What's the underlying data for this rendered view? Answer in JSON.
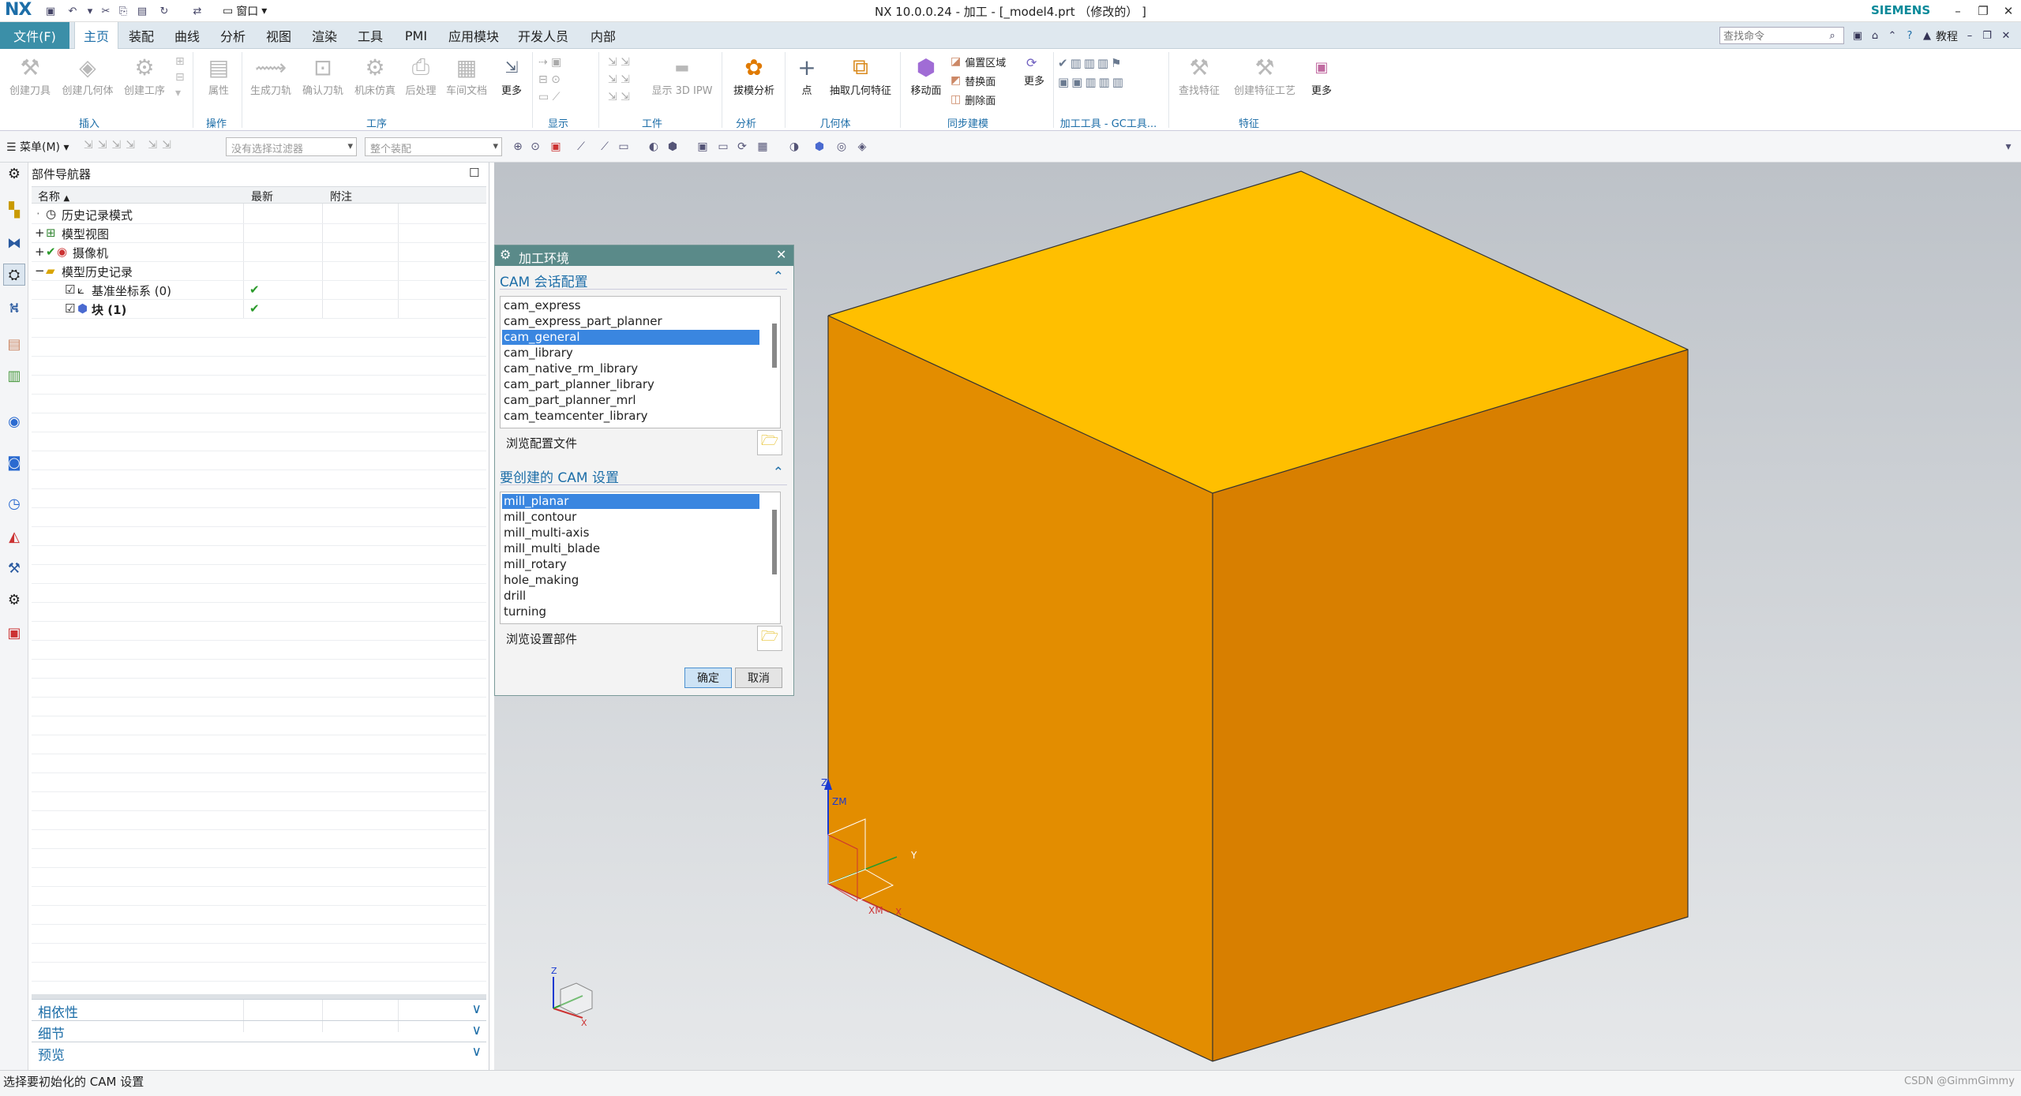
{
  "titlebar": {
    "logo": "NX",
    "window_menu": "窗口",
    "title": "NX 10.0.0.24 - 加工 - [_model4.prt （修改的） ]",
    "brand": "SIEMENS"
  },
  "menu": {
    "file": "文件(F)",
    "tabs": [
      "主页",
      "装配",
      "曲线",
      "分析",
      "视图",
      "渲染",
      "工具",
      "PMI",
      "应用模块",
      "开发人员",
      "内部"
    ],
    "search_placeholder": "查找命令",
    "help_label": "教程"
  },
  "ribbon": {
    "buttons": [
      {
        "label": "创建刀具",
        "icon": "tool-icon"
      },
      {
        "label": "创建几何体",
        "icon": "geometry-icon"
      },
      {
        "label": "创建工序",
        "icon": "operation-icon"
      },
      {
        "label": "属性",
        "icon": "properties-icon"
      },
      {
        "label": "生成刀轨",
        "icon": "generate-path-icon"
      },
      {
        "label": "确认刀轨",
        "icon": "verify-path-icon"
      },
      {
        "label": "机床仿真",
        "icon": "machine-sim-icon"
      },
      {
        "label": "后处理",
        "icon": "postprocess-icon"
      },
      {
        "label": "车间文档",
        "icon": "shop-doc-icon"
      },
      {
        "label": "更多",
        "icon": "more-icon"
      },
      {
        "label": "显示 3D IPW",
        "icon": "ipw-icon"
      },
      {
        "label": "拔模分析",
        "icon": "draft-analysis-icon"
      },
      {
        "label": "点",
        "icon": "point-icon"
      },
      {
        "label": "抽取几何特征",
        "icon": "extract-geometry-icon"
      },
      {
        "label": "移动面",
        "icon": "move-face-icon"
      },
      {
        "label": "更多",
        "icon": "more-icon"
      },
      {
        "label": "查找特征",
        "icon": "find-feature-icon"
      },
      {
        "label": "创建特征工艺",
        "icon": "feature-process-icon"
      },
      {
        "label": "更多",
        "icon": "more-icon"
      }
    ],
    "sync_items": [
      "偏置区域",
      "替换面",
      "删除面"
    ],
    "groups": [
      "插入",
      "操作",
      "工序",
      "显示",
      "工件",
      "分析",
      "几何体",
      "同步建模",
      "加工工具 - GC工具...",
      "特征"
    ]
  },
  "selection_bar": {
    "menu_label": "菜单(M)",
    "filter_placeholder": "没有选择过滤器",
    "scope_placeholder": "整个装配"
  },
  "navigator": {
    "title": "部件导航器",
    "columns": [
      "名称",
      "最新",
      "附注"
    ],
    "rows": [
      {
        "name": "历史记录模式",
        "latest": ""
      },
      {
        "name": "模型视图",
        "latest": ""
      },
      {
        "name": "摄像机",
        "latest": ""
      },
      {
        "name": "模型历史记录",
        "latest": ""
      },
      {
        "name": "基准坐标系 (0)",
        "latest": "✔"
      },
      {
        "name": "块 (1)",
        "latest": "✔"
      }
    ],
    "panels": [
      "相依性",
      "细节",
      "预览"
    ]
  },
  "dialog": {
    "title": "加工环境",
    "session_header": "CAM 会话配置",
    "session_items": [
      "cam_express",
      "cam_express_part_planner",
      "cam_general",
      "cam_library",
      "cam_native_rm_library",
      "cam_part_planner_library",
      "cam_part_planner_mrl",
      "cam_teamcenter_library"
    ],
    "session_selected": "cam_general",
    "browse_config": "浏览配置文件",
    "setup_header": "要创建的 CAM 设置",
    "setup_items": [
      "mill_planar",
      "mill_contour",
      "mill_multi-axis",
      "mill_multi_blade",
      "mill_rotary",
      "hole_making",
      "drill",
      "turning"
    ],
    "setup_selected": "mill_planar",
    "browse_setup": "浏览设置部件",
    "ok": "确定",
    "cancel": "取消"
  },
  "viewport": {
    "axis_labels": [
      "Z",
      "ZM",
      "Y",
      "XM",
      "X"
    ],
    "triad_labels": [
      "Z",
      "X"
    ],
    "colors": {
      "top": "#FFBF00",
      "front": "#E38D00",
      "side": "#D87F00"
    }
  },
  "status": {
    "prompt": "选择要初始化的 CAM 设置",
    "watermark": "CSDN @GimmGimmy"
  }
}
